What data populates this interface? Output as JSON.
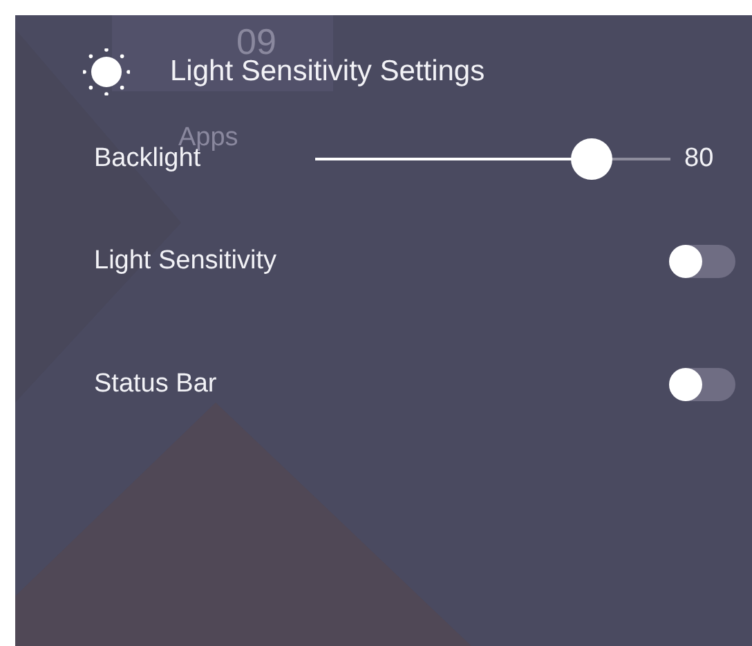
{
  "background": {
    "clock": "09",
    "app_label": "Apps"
  },
  "header": {
    "title": "Light Sensitivity Settings"
  },
  "settings": [
    {
      "kind": "slider",
      "label": "Backlight",
      "level": 0.78,
      "reading": "80"
    },
    {
      "kind": "toggle",
      "label": "Light Sensitivity",
      "on": false
    },
    {
      "kind": "toggle",
      "label": "Status Bar",
      "on": false
    }
  ]
}
